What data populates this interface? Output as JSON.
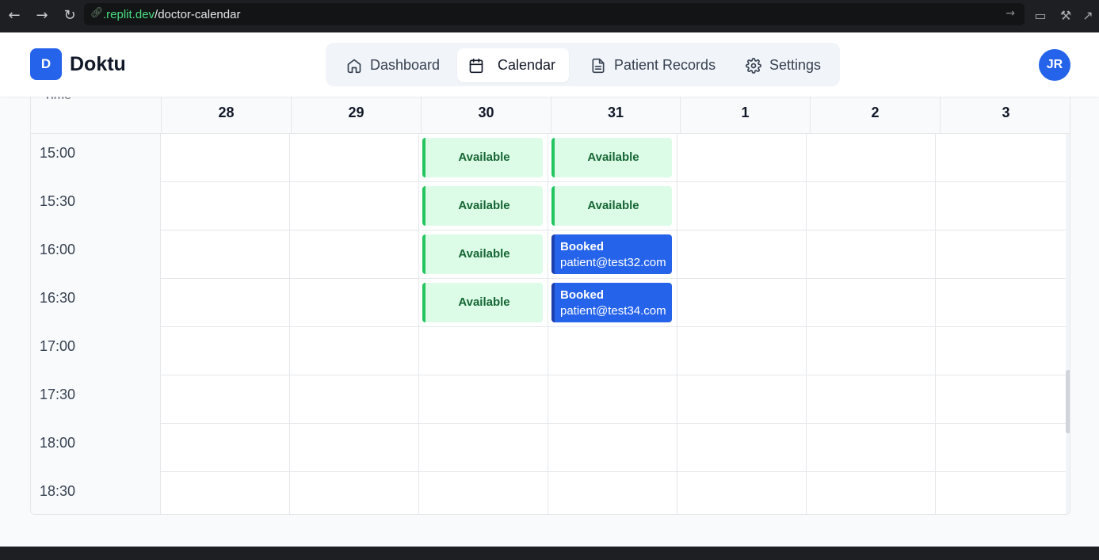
{
  "browser": {
    "url_host": ".replit.dev",
    "url_path": "/doctor-calendar",
    "back_icon": "arrow-left-icon",
    "forward_icon": "arrow-right-icon",
    "reload_icon": "reload-icon"
  },
  "header": {
    "logo_letter": "D",
    "app_name": "Doktu",
    "nav": [
      {
        "label": "Dashboard",
        "icon": "home-icon"
      },
      {
        "label": "Calendar",
        "icon": "calendar-icon",
        "active": true
      },
      {
        "label": "Patient Records",
        "icon": "document-icon"
      },
      {
        "label": "Settings",
        "icon": "gear-icon"
      }
    ],
    "avatar_initials": "JR"
  },
  "calendar": {
    "time_header": "Time",
    "days": [
      "28",
      "29",
      "30",
      "31",
      "1",
      "2",
      "3"
    ],
    "rows": [
      {
        "time": "15:00",
        "slots": {
          "2": {
            "status": "Available"
          },
          "3": {
            "status": "Available"
          }
        }
      },
      {
        "time": "15:30",
        "slots": {
          "2": {
            "status": "Available"
          },
          "3": {
            "status": "Available"
          }
        }
      },
      {
        "time": "16:00",
        "slots": {
          "2": {
            "status": "Available"
          },
          "3": {
            "status": "Booked",
            "email": "patient@test32.com"
          }
        }
      },
      {
        "time": "16:30",
        "slots": {
          "2": {
            "status": "Available"
          },
          "3": {
            "status": "Booked",
            "email": "patient@test34.com"
          }
        }
      },
      {
        "time": "17:00",
        "slots": {}
      },
      {
        "time": "17:30",
        "slots": {}
      },
      {
        "time": "18:00",
        "slots": {}
      },
      {
        "time": "18:30",
        "slots": {}
      }
    ]
  },
  "colors": {
    "accent": "#2563eb",
    "available_bg": "#dcfce7",
    "available_border": "#22c55e",
    "available_text": "#166534"
  }
}
